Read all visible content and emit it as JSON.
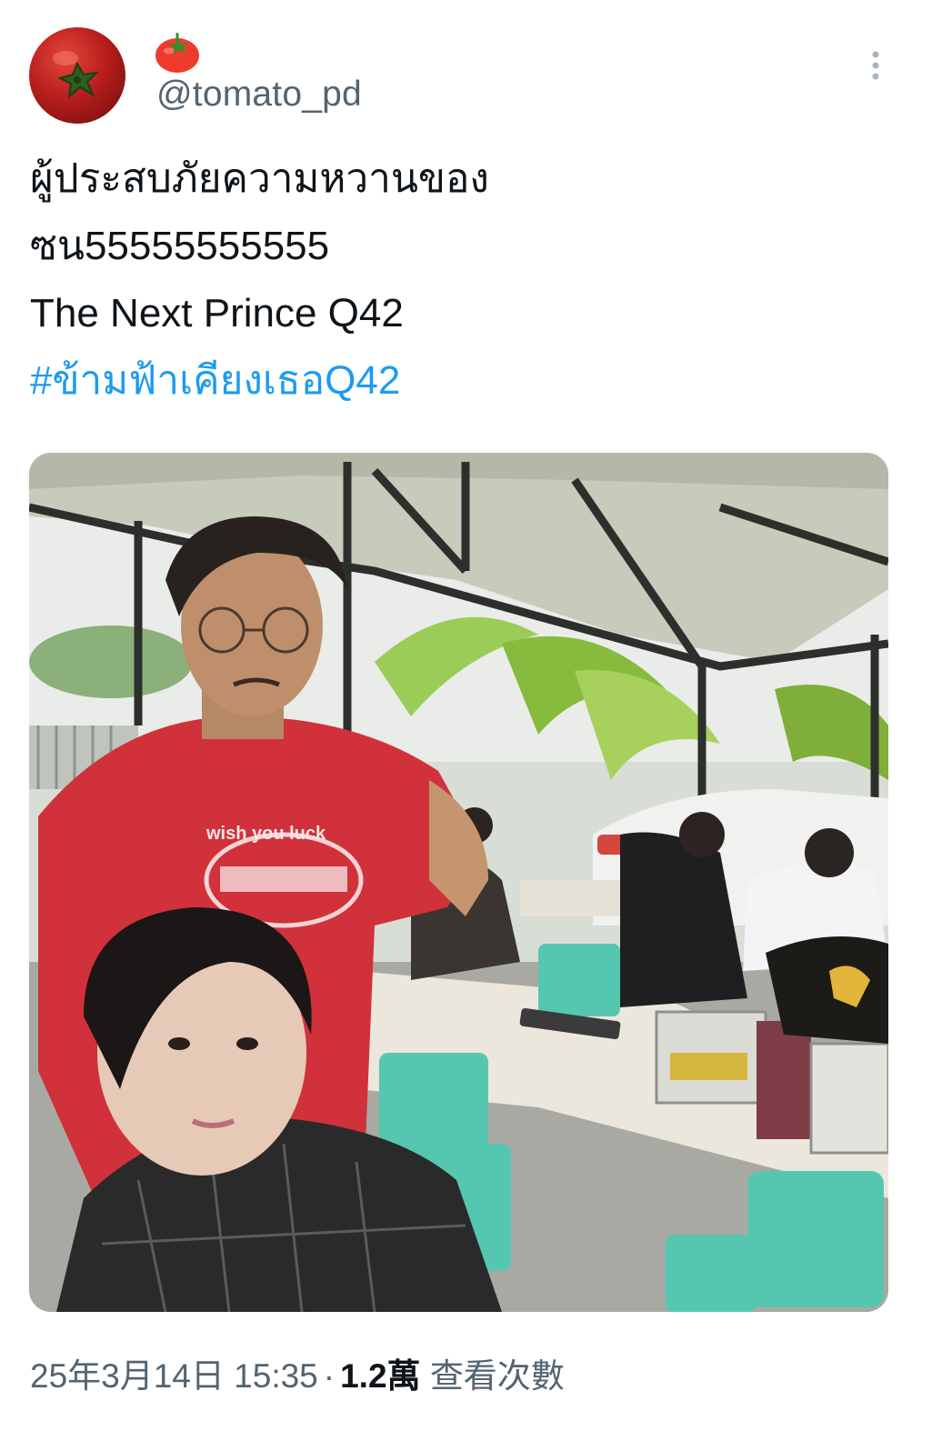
{
  "author": {
    "display_name": "🍅",
    "handle": "@tomato_pd"
  },
  "tweet": {
    "lines": [
      "ผู้ประสบภัยความหวานของ",
      "ซน55555555555",
      "The Next Prince Q42"
    ],
    "hashtag": "#ข้ามฟ้าเคียงเธอQ42"
  },
  "media": {
    "shirt_text": "wish you luck"
  },
  "meta": {
    "timestamp": "25年3月14日 15:35",
    "separator": "·",
    "views_count": "1.2萬",
    "views_label": "查看次數"
  },
  "colors": {
    "text": "#0f1419",
    "secondary": "#536471",
    "link": "#1d9bf0"
  }
}
